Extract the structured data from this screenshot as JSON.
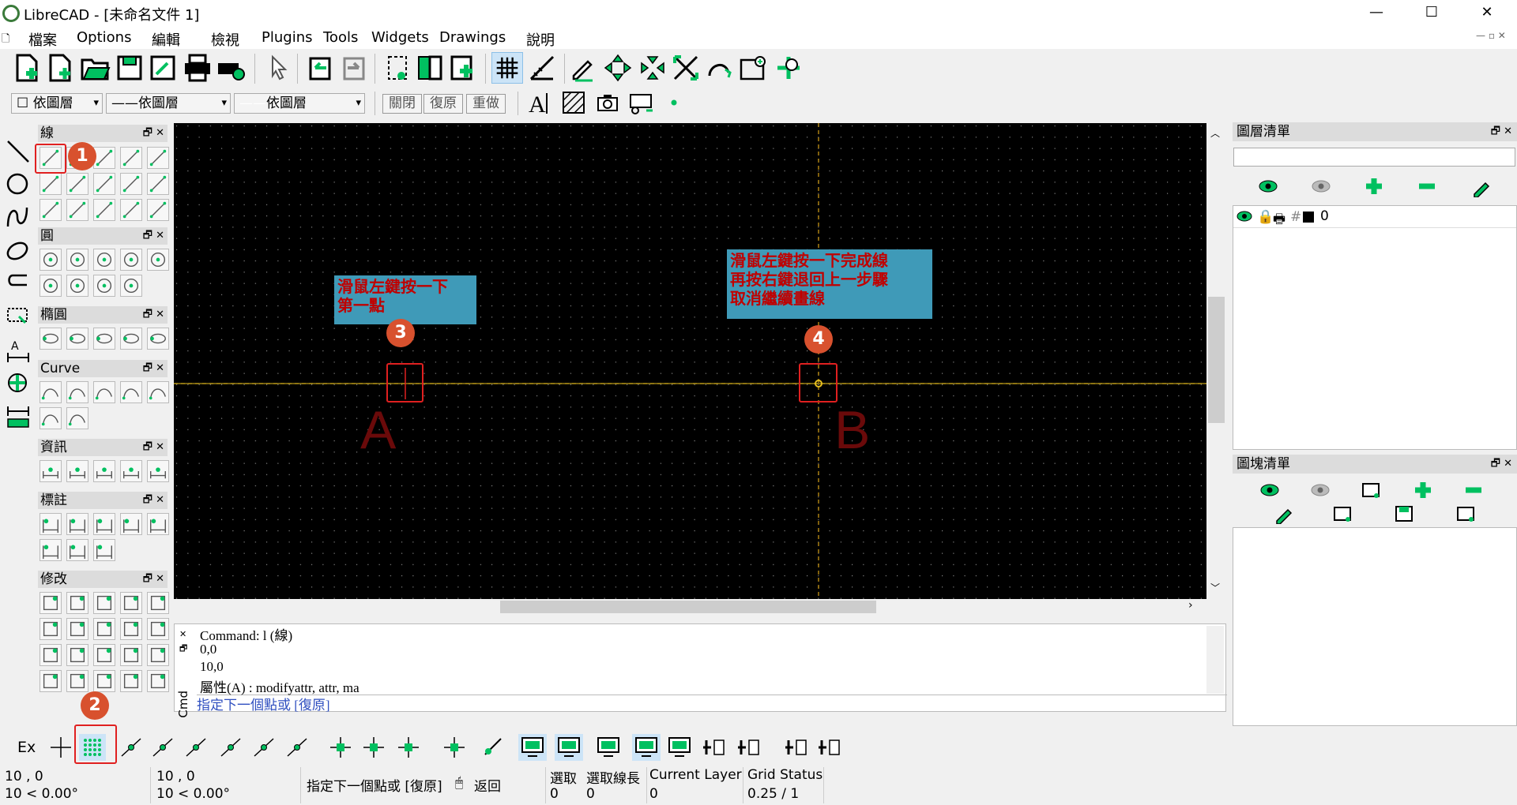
{
  "window": {
    "title": "LibreCAD - [未命名文件 1]",
    "minimize": "—",
    "maximize": "☐",
    "close": "✕"
  },
  "menu": [
    "檔案",
    "Options",
    "編輯",
    "檢視",
    "Plugins",
    "Tools",
    "Widgets",
    "Drawings",
    "說明"
  ],
  "pen": {
    "layer_combo": "依圖層",
    "linetype_combo": "依圖層",
    "width_combo": "依圖層",
    "close_btn": "關閉",
    "undo_btn": "復原",
    "redo_btn": "重做"
  },
  "docks": {
    "line": "線",
    "circle": "圓",
    "ellipse": "橢圓",
    "curve": "Curve",
    "info": "資訊",
    "dimension": "標註",
    "modify": "修改",
    "float": "🗗",
    "close": "✕"
  },
  "callouts": {
    "c1": "滑鼠左鍵按一下\n第一點",
    "c2": "滑鼠左鍵按一下完成線\n再按右鍵退回上一步驟\n取消繼續畫線"
  },
  "badges": [
    "1",
    "2",
    "3",
    "4"
  ],
  "points": {
    "a": "A",
    "b": "B"
  },
  "command": {
    "lines": [
      "Command: l (線)",
      "0,0",
      "10,0",
      "屬性(A) : modifyattr, attr, ma"
    ],
    "prompt": "指定下一個點或 [復原]",
    "side_label": "Cmd"
  },
  "layers": {
    "title": "圖層清單",
    "search_placeholder": "",
    "layer_name": "0",
    "layer_color": "#000000"
  },
  "blocks": {
    "title": "圖塊清單"
  },
  "snap": {
    "ex_label": "Ex"
  },
  "status": {
    "abs_coord": "10 , 0",
    "abs_polar": "10 < 0.00°",
    "rel_coord": "10 , 0",
    "rel_polar": "10 < 0.00°",
    "prompt": "指定下一個點或 [復原]",
    "back": "返回",
    "selected_label": "選取",
    "selected_val": "0",
    "sel_len_label": "選取線長",
    "sel_len_val": "0",
    "layer_label": "Current Layer",
    "layer_val": "0",
    "grid_label": "Grid Status",
    "grid_val": "0.25 / 1"
  },
  "colors": {
    "green_icon": "#00c060",
    "accent_red": "#d8512e",
    "callout_bg": "#3f9ab8"
  }
}
